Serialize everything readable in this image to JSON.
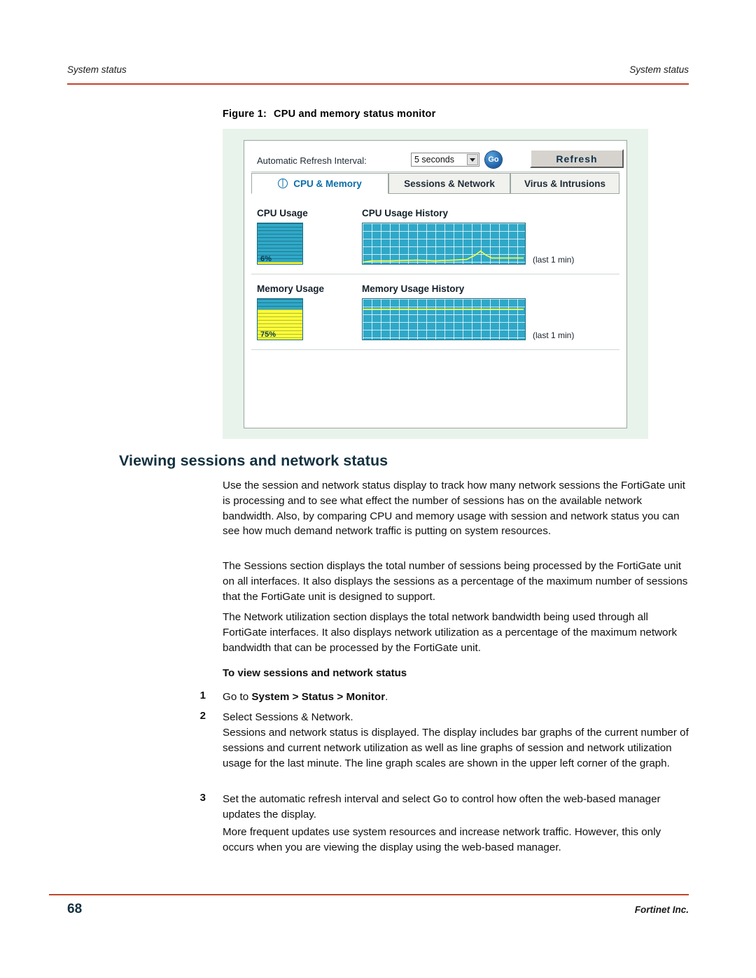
{
  "header": {
    "left": "System status",
    "right": "System status"
  },
  "figure": {
    "caption_label": "Figure 1:",
    "caption_text": "CPU and memory status monitor",
    "refresh": {
      "label": "Automatic Refresh Interval:",
      "interval_value": "5 seconds",
      "go_label": "Go",
      "refresh_label": "Refresh"
    },
    "tabs": [
      {
        "label": "CPU & Memory",
        "active": true
      },
      {
        "label": "Sessions & Network",
        "active": false
      },
      {
        "label": "Virus & Intrusions",
        "active": false
      }
    ],
    "cpu": {
      "usage_title": "CPU Usage",
      "history_title": "CPU Usage History",
      "usage_percent": "6%",
      "usage_value": 6,
      "history_note": "(last 1 min)"
    },
    "memory": {
      "usage_title": "Memory Usage",
      "history_title": "Memory Usage History",
      "usage_percent": "75%",
      "usage_value": 75,
      "history_note": "(last 1 min)"
    }
  },
  "body": {
    "section_heading": "Viewing sessions and network status",
    "para1": "Use the session and network status display to track how many network sessions the FortiGate unit is processing and to see what effect the number of sessions has on the available network bandwidth. Also, by comparing CPU and memory usage with session and network status you can see how much demand network traffic is putting on system resources.",
    "para2": "The Sessions section displays the total number of sessions being processed by the FortiGate unit on all interfaces. It also displays the sessions as a percentage of the maximum number of sessions that the FortiGate unit is designed to support.",
    "para3": "The Network utilization section displays the total network bandwidth being used through all FortiGate interfaces. It also displays network utilization as a percentage of the maximum network bandwidth that can be processed by the FortiGate unit.",
    "procedure_heading": "To view sessions and network status",
    "step1_num": "1",
    "step1_prefix": "Go to ",
    "step1_bold": "System > Status > Monitor",
    "step1_suffix": ".",
    "step2_num": "2",
    "step2_text": "Select Sessions & Network.",
    "step2_detail": "Sessions and network status is displayed. The display includes bar graphs of the current number of sessions and current network utilization as well as line graphs of session and network utilization usage for the last minute. The line graph scales are shown in the upper left corner of the graph.",
    "step3_num": "3",
    "step3_text": "Set the automatic refresh interval and select Go to control how often the web-based manager updates the display.",
    "step3_detail": "More frequent updates use system resources and increase network traffic. However, this only occurs when you are viewing the display using the web-based manager."
  },
  "footer": {
    "page_number": "68",
    "company": "Fortinet Inc."
  }
}
